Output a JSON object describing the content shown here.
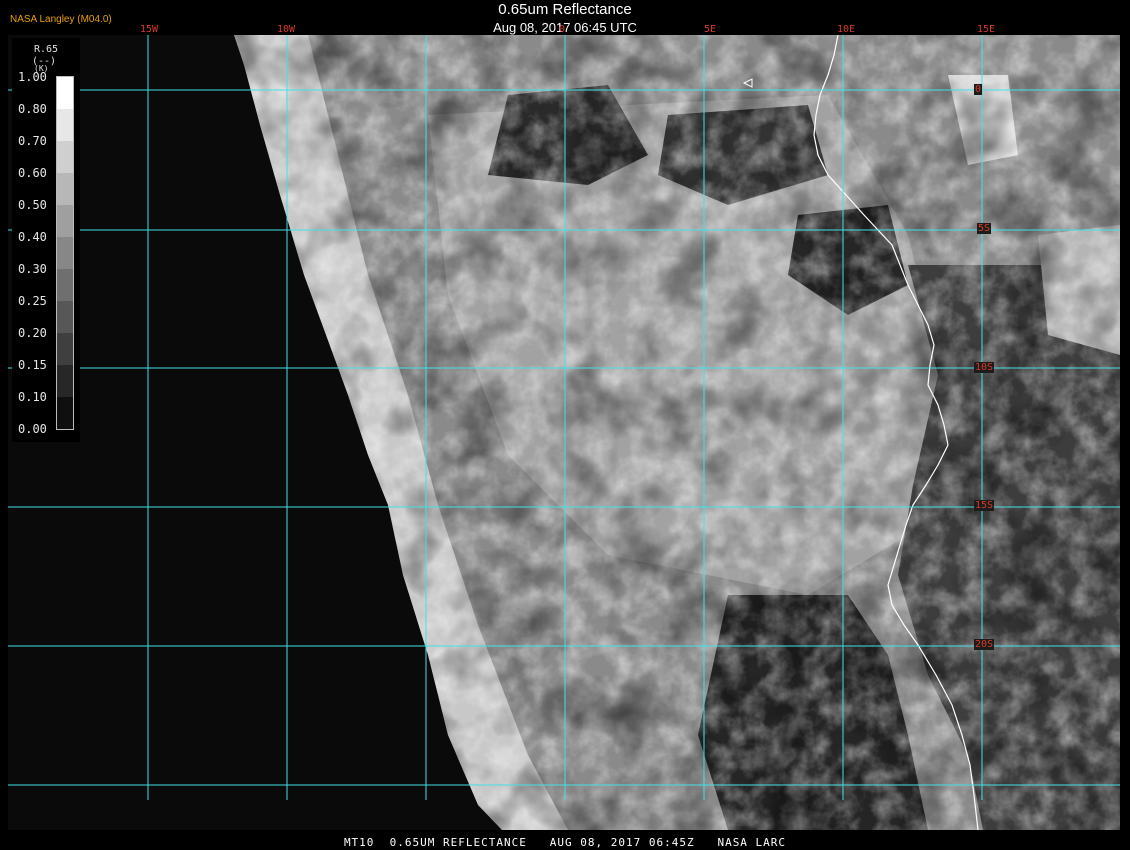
{
  "header": {
    "title": "0.65um Reflectance",
    "subtitle": "Aug 08, 2017 06:45 UTC",
    "source": "NASA Langley (M04.0)"
  },
  "footer": {
    "caption": "MT10  0.65UM REFLECTANCE   AUG 08, 2017 06:45Z   NASA LARC"
  },
  "legend": {
    "name": "R.65",
    "unit": "(--)",
    "unit_extra": "(K)",
    "ticks": [
      "1.00",
      "0.80",
      "0.70",
      "0.60",
      "0.50",
      "0.40",
      "0.30",
      "0.25",
      "0.20",
      "0.15",
      "0.10",
      "0.00"
    ]
  },
  "longitudes": [
    "15W",
    "10W",
    "0",
    "5E",
    "10E",
    "15E"
  ],
  "latitudes": [
    "0",
    "5S",
    "10S",
    "15S",
    "20S"
  ],
  "colors": {
    "gridline": "#40e0e8",
    "grid_label": "#d83a2a",
    "coastline": "#ffffff",
    "source_label": "#e8a000",
    "ocean_background": "#0a0a0a"
  }
}
